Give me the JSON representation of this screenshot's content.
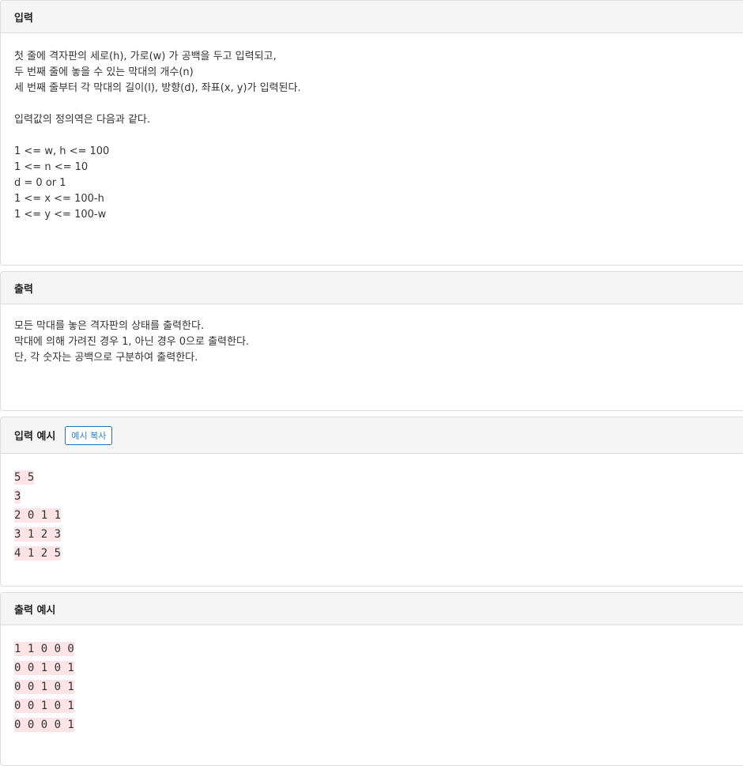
{
  "input_section": {
    "title": "입력",
    "lines": [
      "첫 줄에 격자판의 세로(h), 가로(w) 가 공백을 두고 입력되고,",
      "두 번째 줄에 놓을 수 있는 막대의 개수(n)",
      "세 번째 줄부터 각 막대의 길이(l), 방향(d), 좌표(x, y)가 입력된다.",
      "",
      "입력값의 정의역은 다음과 같다.",
      "",
      "1 <= w, h <= 100",
      "1 <= n <= 10",
      "d = 0 or 1",
      "1 <= x <= 100-h",
      "1 <= y <= 100-w"
    ]
  },
  "output_section": {
    "title": "출력",
    "lines": [
      "모든 막대를 놓은 격자판의 상태를 출력한다.",
      "막대에 의해 가려진 경우 1, 아닌 경우 0으로 출력한다.",
      "단, 각 숫자는 공백으로 구분하여 출력한다."
    ]
  },
  "sample_input": {
    "title": "입력 예시",
    "copy_button": "예시 복사",
    "lines": [
      "5 5",
      "3",
      "2 0 1 1",
      "3 1 2 3",
      "4 1 2 5"
    ]
  },
  "sample_output": {
    "title": "출력 예시",
    "lines": [
      "1 1 0 0 0",
      "0 0 1 0 1",
      "0 0 1 0 1",
      "0 0 1 0 1",
      "0 0 0 0 1"
    ]
  }
}
